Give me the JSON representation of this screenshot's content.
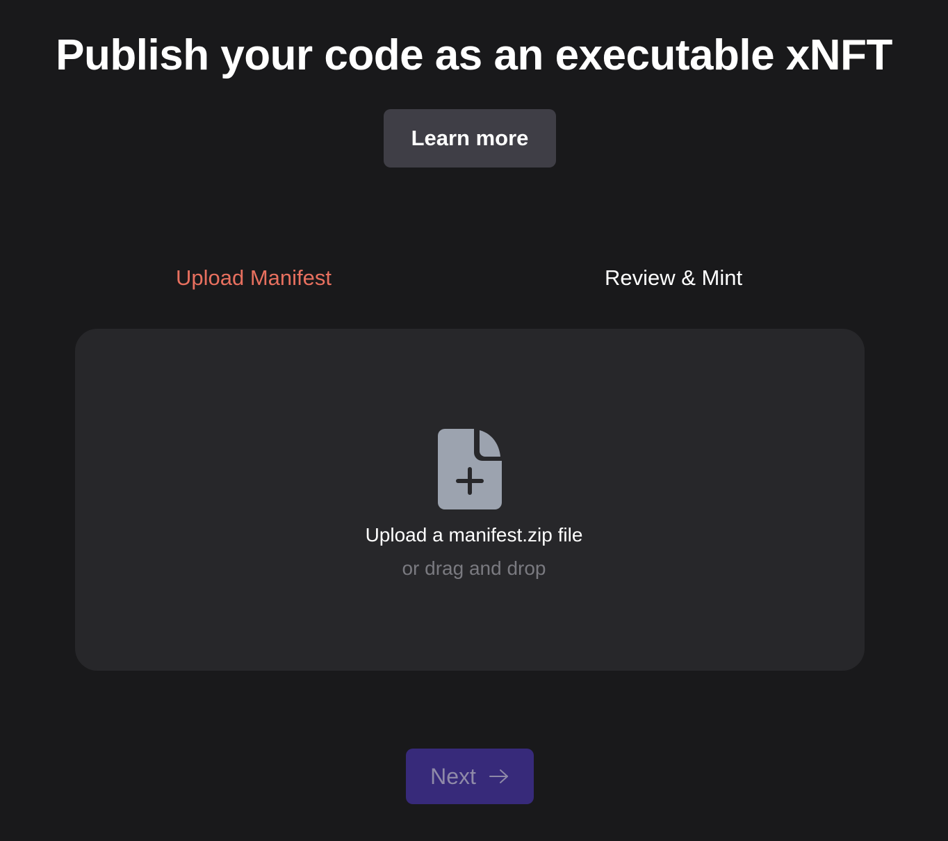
{
  "header": {
    "title": "Publish your code as an executable xNFT",
    "learn_more_label": "Learn more"
  },
  "steps": [
    {
      "label": "Upload Manifest",
      "active": true
    },
    {
      "label": "Review & Mint",
      "active": false
    }
  ],
  "dropzone": {
    "icon": "file-plus-icon",
    "primary_text": "Upload a manifest.zip file",
    "secondary_text": "or drag and drop"
  },
  "footer": {
    "next_label": "Next",
    "next_icon": "arrow-right-icon"
  },
  "colors": {
    "background": "#19191b",
    "active_step": "#e8705f",
    "next_button": "#372a7a",
    "dropzone": "#27272a"
  }
}
